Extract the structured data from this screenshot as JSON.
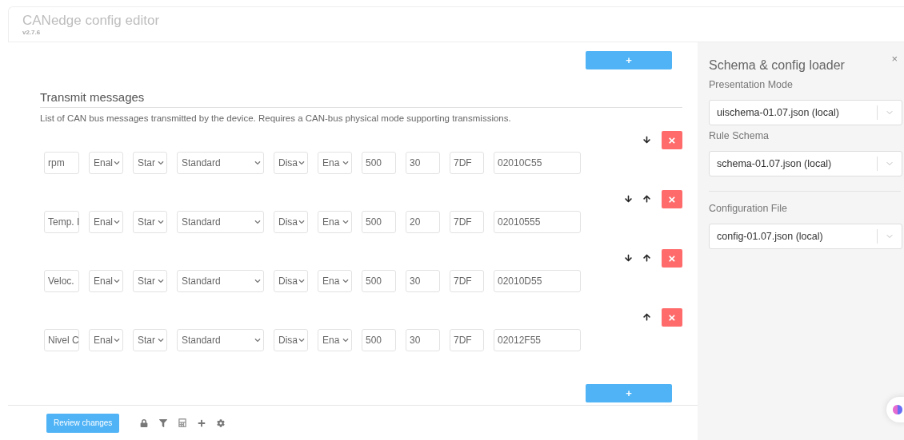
{
  "header": {
    "title": "CANedge config editor",
    "version": "v2.7.6"
  },
  "main": {
    "add_top": "+",
    "section_title": "Transmit messages",
    "description": "List of CAN bus messages transmitted by the device. Requires a CAN-bus physical mode supporting transmissions.",
    "remove_label": "×",
    "rows": [
      {
        "can_move_down": true,
        "can_move_up": false,
        "cells": [
          {
            "kind": "input",
            "value": "rpm"
          },
          {
            "kind": "select",
            "value": "Enal"
          },
          {
            "kind": "select",
            "value": "Star"
          },
          {
            "kind": "select",
            "value": "Standard"
          },
          {
            "kind": "select",
            "value": "Disa"
          },
          {
            "kind": "select",
            "value": "Ena"
          },
          {
            "kind": "input",
            "value": "500"
          },
          {
            "kind": "input",
            "value": "30"
          },
          {
            "kind": "input",
            "value": "7DF"
          },
          {
            "kind": "input",
            "value": "02010C55"
          }
        ]
      },
      {
        "can_move_down": true,
        "can_move_up": true,
        "cells": [
          {
            "kind": "input",
            "value": "Temp. I"
          },
          {
            "kind": "select",
            "value": "Enal"
          },
          {
            "kind": "select",
            "value": "Star"
          },
          {
            "kind": "select",
            "value": "Standard"
          },
          {
            "kind": "select",
            "value": "Disa"
          },
          {
            "kind": "select",
            "value": "Ena"
          },
          {
            "kind": "input",
            "value": "500"
          },
          {
            "kind": "input",
            "value": "20"
          },
          {
            "kind": "input",
            "value": "7DF"
          },
          {
            "kind": "input",
            "value": "02010555"
          }
        ]
      },
      {
        "can_move_down": true,
        "can_move_up": true,
        "cells": [
          {
            "kind": "input",
            "value": "Veloc."
          },
          {
            "kind": "select",
            "value": "Enal"
          },
          {
            "kind": "select",
            "value": "Star"
          },
          {
            "kind": "select",
            "value": "Standard"
          },
          {
            "kind": "select",
            "value": "Disa"
          },
          {
            "kind": "select",
            "value": "Ena"
          },
          {
            "kind": "input",
            "value": "500"
          },
          {
            "kind": "input",
            "value": "30"
          },
          {
            "kind": "input",
            "value": "7DF"
          },
          {
            "kind": "input",
            "value": "02010D55"
          }
        ]
      },
      {
        "can_move_down": false,
        "can_move_up": true,
        "cells": [
          {
            "kind": "input",
            "value": "Nivel C"
          },
          {
            "kind": "select",
            "value": "Enal"
          },
          {
            "kind": "select",
            "value": "Star"
          },
          {
            "kind": "select",
            "value": "Standard"
          },
          {
            "kind": "select",
            "value": "Disa"
          },
          {
            "kind": "select",
            "value": "Ena"
          },
          {
            "kind": "input",
            "value": "500"
          },
          {
            "kind": "input",
            "value": "30"
          },
          {
            "kind": "input",
            "value": "7DF"
          },
          {
            "kind": "input",
            "value": "02012F55"
          }
        ]
      }
    ],
    "add_bottom": "+"
  },
  "footer": {
    "review_button": "Review changes"
  },
  "sidebar": {
    "title": "Schema & config loader",
    "close": "×",
    "sections": [
      {
        "label": "Presentation Mode",
        "value": "uischema-01.07.json (local)",
        "divider_before": false
      },
      {
        "label": "Rule Schema",
        "value": "schema-01.07.json (local)",
        "divider_before": false
      },
      {
        "label": "Configuration File",
        "value": "config-01.07.json (local)",
        "divider_before": true
      }
    ]
  }
}
